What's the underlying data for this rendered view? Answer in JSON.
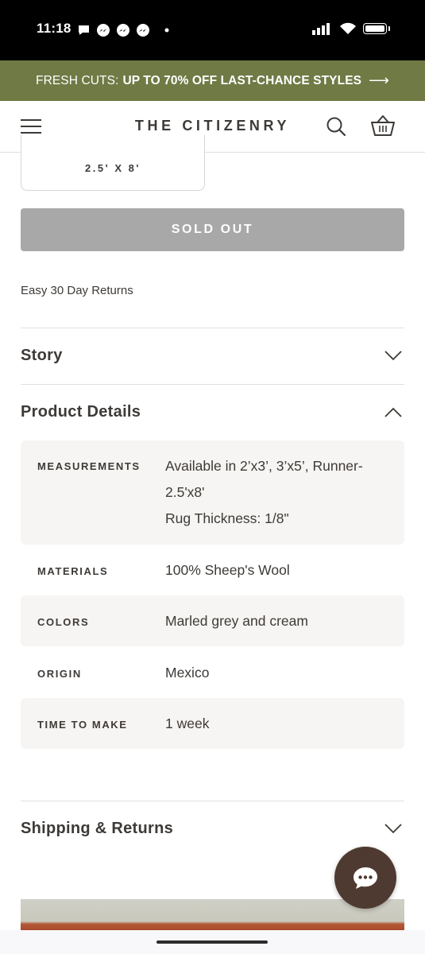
{
  "status_bar": {
    "time": "11:18",
    "notification_icons": [
      "chat-bubble-icon",
      "messenger-icon",
      "messenger-icon",
      "messenger-icon",
      "dot-icon"
    ],
    "right_icons": [
      "signal-icon",
      "wifi-icon",
      "battery-icon"
    ]
  },
  "promo": {
    "prefix": "FRESH CUTS:",
    "highlight": "UP TO 70% OFF LAST-CHANCE STYLES",
    "arrow": "⟶",
    "background": "#6f7a45"
  },
  "header": {
    "logo": "THE CITIZENRY",
    "icons": [
      "hamburger-menu-icon",
      "search-icon",
      "basket-icon"
    ]
  },
  "size_option": {
    "label": "2.5' X 8'"
  },
  "purchase": {
    "button_label": "SOLD OUT",
    "returns_note": "Easy 30 Day Returns"
  },
  "accordions": {
    "story": {
      "title": "Story",
      "state": "collapsed"
    },
    "product_details": {
      "title": "Product Details",
      "state": "expanded",
      "rows": [
        {
          "label": "MEASUREMENTS",
          "value_lines": [
            "Available in 2’x3’, 3’x5’, Runner-",
            "2.5'x8'",
            "Rug Thickness: 1/8\""
          ]
        },
        {
          "label": "MATERIALS",
          "value": "100% Sheep's Wool"
        },
        {
          "label": "COLORS",
          "value": "Marled grey and cream"
        },
        {
          "label": "ORIGIN",
          "value": "Mexico"
        },
        {
          "label": "TIME TO MAKE",
          "value": "1 week"
        }
      ]
    },
    "shipping_returns": {
      "title": "Shipping & Returns",
      "state": "collapsed"
    }
  },
  "chat": {
    "icon": "chat-ellipsis-icon",
    "color": "#4e3a30"
  }
}
